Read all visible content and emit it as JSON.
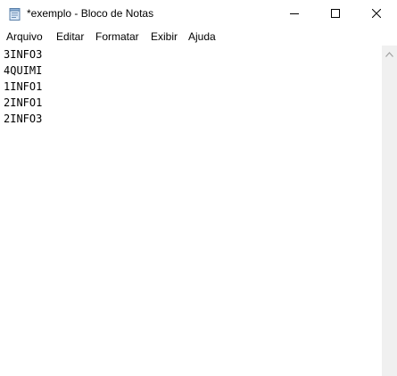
{
  "window": {
    "title": "*exemplo - Bloco de Notas",
    "icon": "notepad-icon"
  },
  "menu": {
    "items": [
      {
        "label": "Arquivo"
      },
      {
        "label": "Editar"
      },
      {
        "label": "Formatar"
      },
      {
        "label": "Exibir"
      },
      {
        "label": "Ajuda"
      }
    ]
  },
  "editor": {
    "lines": [
      "3INFO3",
      "4QUIMI",
      "1INFO1",
      "2INFO1",
      "2INFO3"
    ]
  },
  "controls": {
    "minimize_icon": "minimize-icon",
    "maximize_icon": "maximize-icon",
    "close_icon": "close-icon",
    "scroll_up_icon": "chevron-up-icon"
  }
}
